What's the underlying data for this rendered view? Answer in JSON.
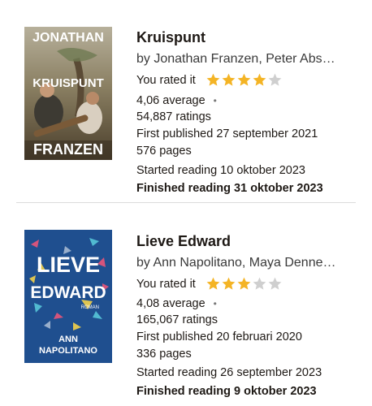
{
  "books": [
    {
      "title": "Kruispunt",
      "authors": "by Jonathan Franzen, Peter Abs…",
      "rated_label": "You rated it",
      "rating_stars": 4,
      "average": "4,06 average",
      "ratings": "54,887 ratings",
      "first_published": "First published 27 september 2021",
      "pages": "576 pages",
      "started": "Started reading 10 oktober 2023",
      "finished": "Finished reading 31 oktober 2023",
      "cover": {
        "top_text": "JONATHAN",
        "middle_text": "KRUISPUNT",
        "bottom_text": "FRANZEN"
      }
    },
    {
      "title": "Lieve Edward",
      "authors": "by Ann Napolitano, Maya Denne…",
      "rated_label": "You rated it",
      "rating_stars": 3,
      "average": "4,08 average",
      "ratings": "165,067 ratings",
      "first_published": "First published 20 februari 2020",
      "pages": "336 pages",
      "started": "Started reading 26 september 2023",
      "finished": "Finished reading 9 oktober 2023",
      "cover": {
        "line1": "LIEVE",
        "line2": "EDWARD",
        "tag": "ROMAN",
        "author1": "ANN",
        "author2": "NAPOLITANO"
      }
    }
  ],
  "colors": {
    "star_filled": "#f4b425",
    "star_empty": "#cfcfcf"
  }
}
